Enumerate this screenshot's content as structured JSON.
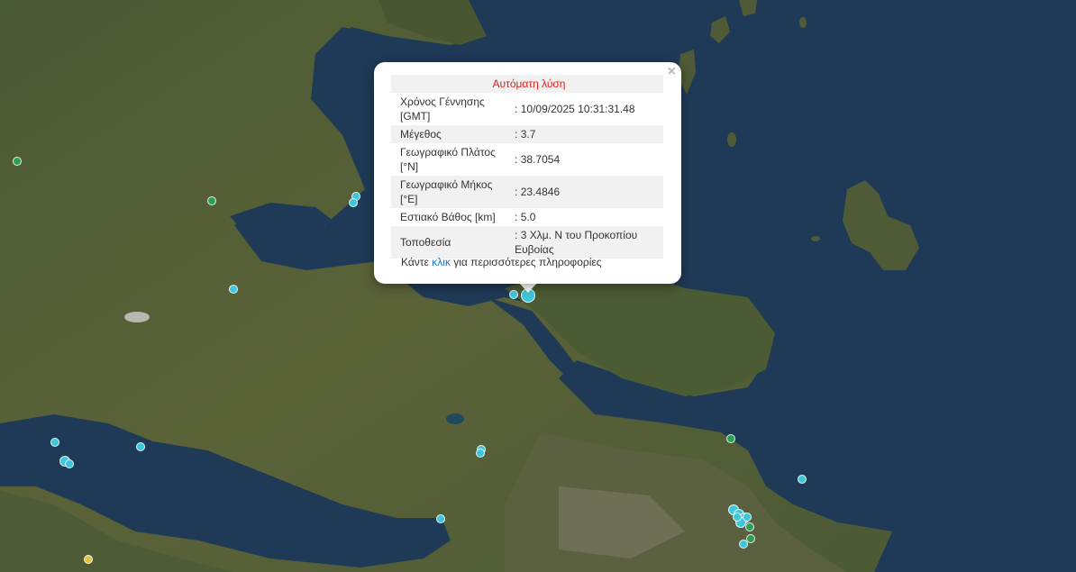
{
  "popup": {
    "title": "Αυτόματη λύση",
    "close": "×",
    "rows": [
      {
        "label": "Χρόνος Γέννησης [GMT]",
        "value": ": 10/09/2025 10:31:31.48"
      },
      {
        "label": "Μέγεθος",
        "value": ": 3.7"
      },
      {
        "label": "Γεωγραφικό Πλάτος [°N]",
        "value": ": 38.7054"
      },
      {
        "label": "Γεωγραφικό Μήκος [°E]",
        "value": ": 23.4846"
      },
      {
        "label": "Εστιακό Βάθος [km]",
        "value": ": 5.0"
      },
      {
        "label": "Τοποθεσία",
        "value": ": 3 Χλμ. Ν του Προκοπίου Ευβοίας"
      }
    ],
    "more_prefix": "Κάντε ",
    "more_link": "κλικ",
    "more_suffix": " για περισσότερες πληροφορίες"
  },
  "colors": {
    "marker_cyan": "#3fc6dc",
    "marker_green": "#2f9e55",
    "marker_yellow": "#e3c443",
    "title_red": "#e0201c",
    "link_blue": "#1a73c8"
  }
}
